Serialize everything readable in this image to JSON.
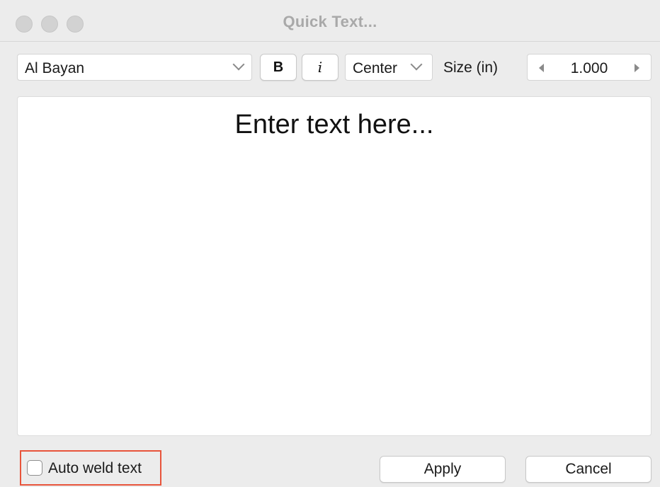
{
  "window": {
    "title": "Quick Text..."
  },
  "toolbar": {
    "font": "Al Bayan",
    "bold_label": "B",
    "italic_label": "i",
    "alignment": "Center",
    "size_label": "Size (in)",
    "size_value": "1.000"
  },
  "editor": {
    "placeholder": "Enter text here..."
  },
  "footer": {
    "auto_weld_label": "Auto weld text",
    "auto_weld_checked": false,
    "apply_label": "Apply",
    "cancel_label": "Cancel"
  },
  "colors": {
    "highlight": "#e8543b",
    "window_bg": "#ececec"
  }
}
